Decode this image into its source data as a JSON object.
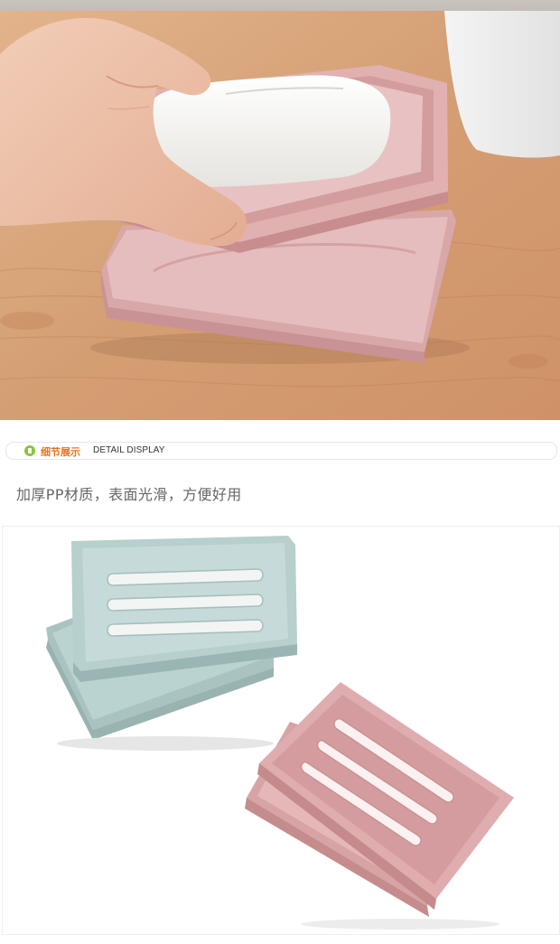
{
  "section_header": {
    "title": "细节展示",
    "subtitle": "DETAIL DISPLAY"
  },
  "caption": "加厚PP材质，表面光滑，方便好用",
  "colors": {
    "accent_orange": "#e8721c",
    "icon_green": "#8bc43f",
    "pink_dish": "#d9a4a6",
    "blue_dish": "#b8d1cf",
    "wood": "#d9a57a"
  }
}
